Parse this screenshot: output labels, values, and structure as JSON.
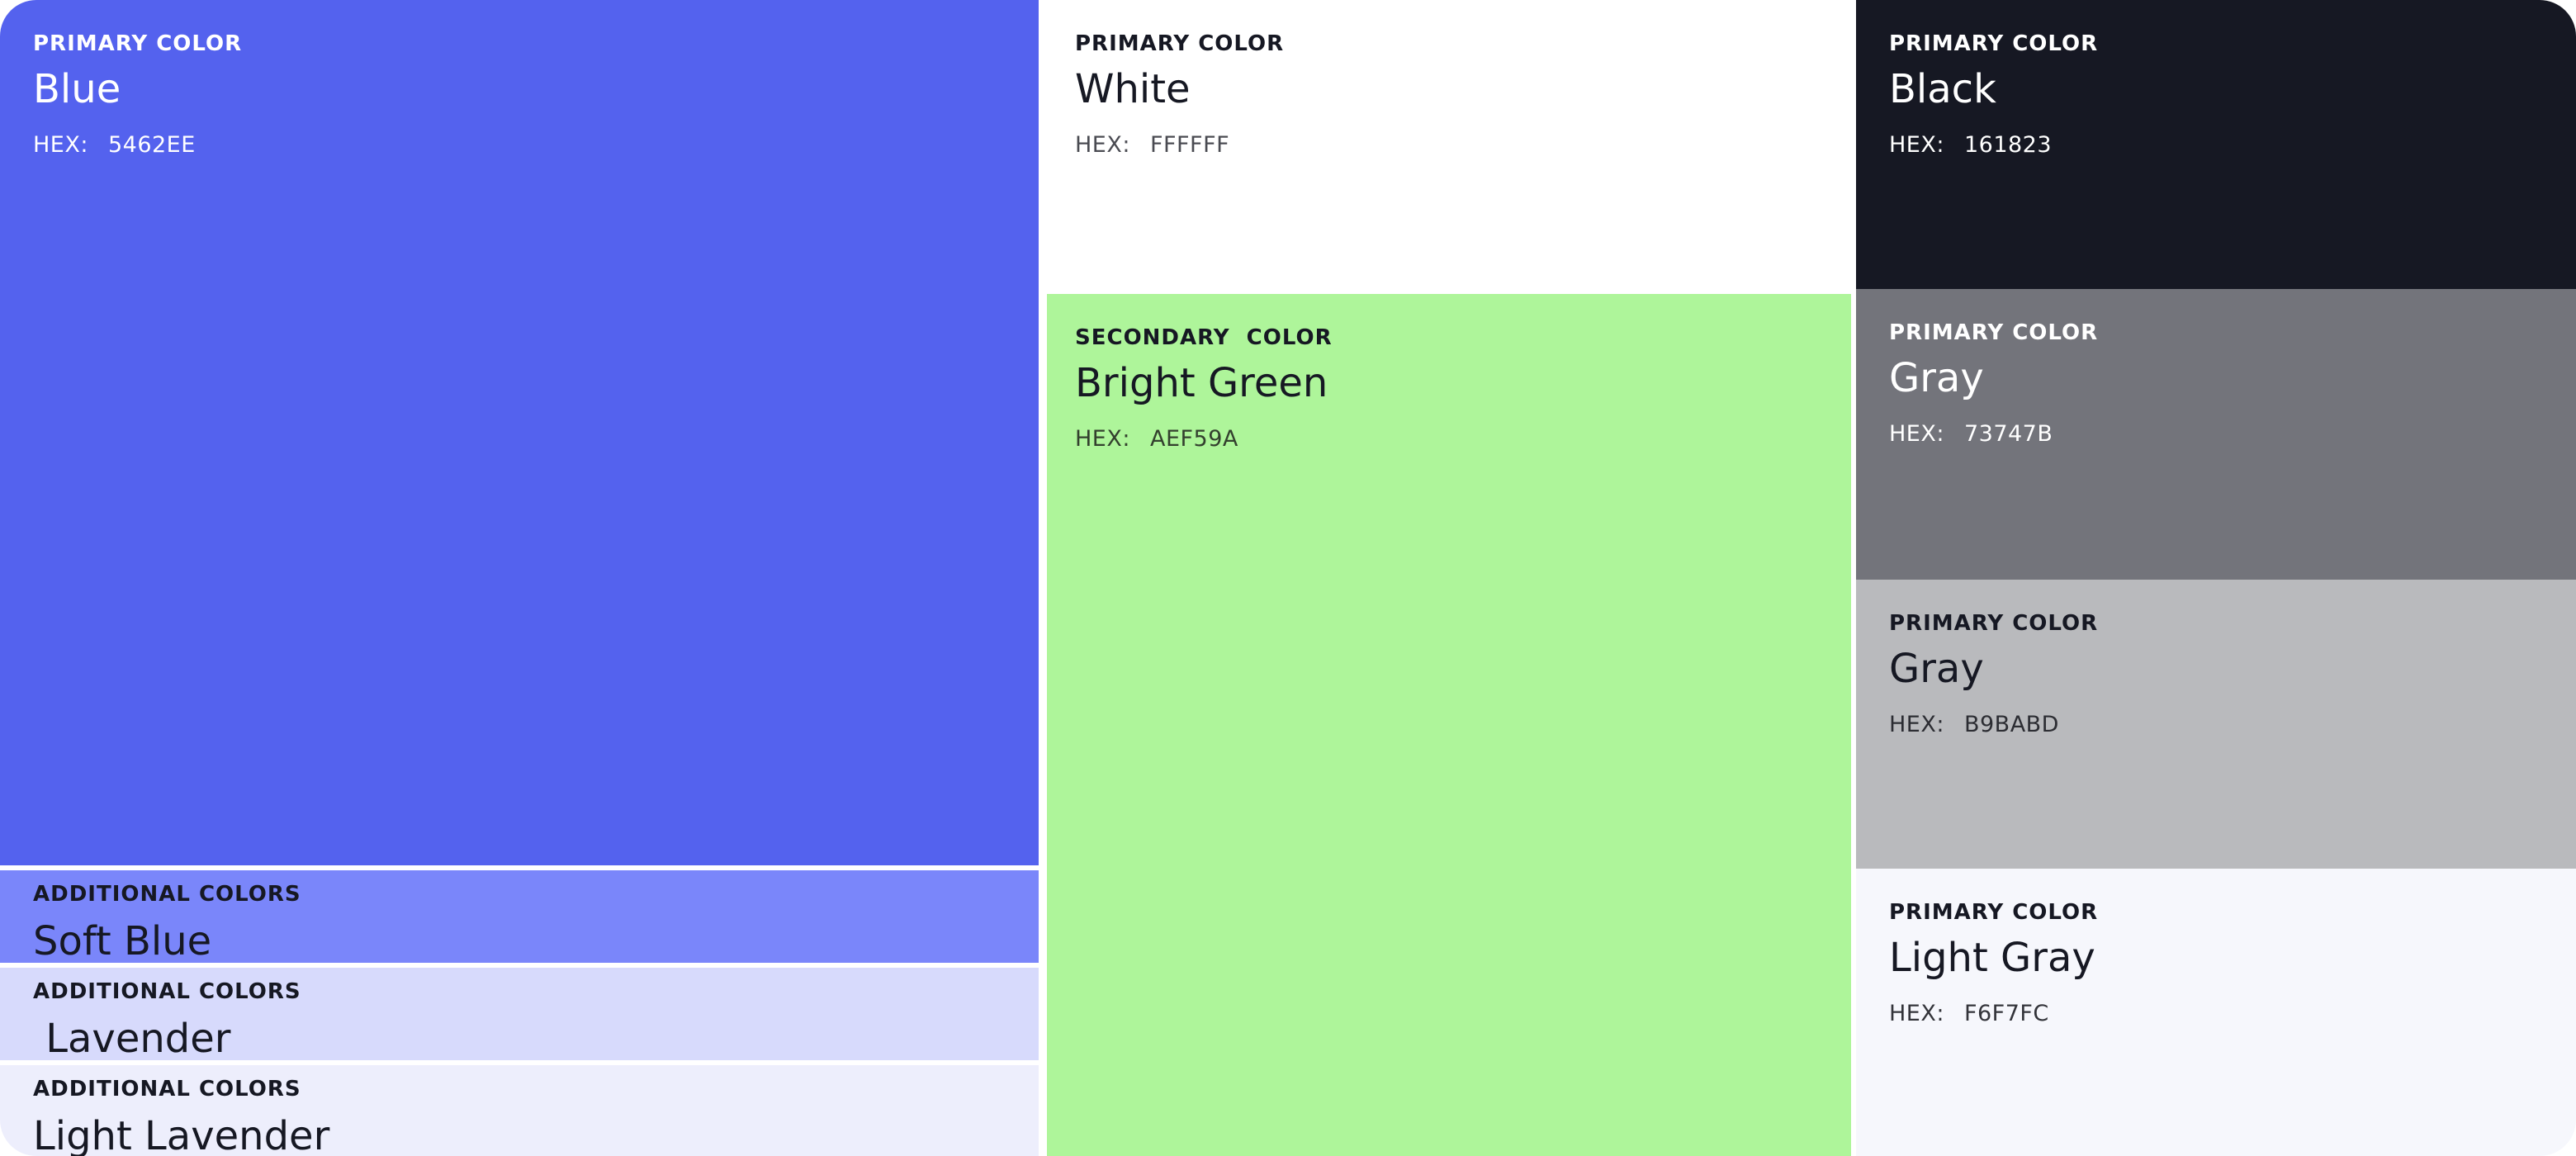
{
  "swatches": {
    "blue": {
      "label": "PRIMARY COLOR",
      "name": "Blue",
      "hex_prefix": "HEX:",
      "hex": "5462EE"
    },
    "soft_blue": {
      "label": "ADDITIONAL COLORS",
      "name": "Soft Blue"
    },
    "lavender": {
      "label": "ADDITIONAL COLORS",
      "name": " Lavender"
    },
    "light_lavender": {
      "label": "ADDITIONAL COLORS",
      "name": "Light Lavender"
    },
    "white": {
      "label": "PRIMARY COLOR",
      "name": "White",
      "hex_prefix": "HEX:",
      "hex": "FFFFFF"
    },
    "bright_green": {
      "label": "SECONDARY  COLOR",
      "name": "Bright Green",
      "hex_prefix": "HEX:",
      "hex": "AEF59A"
    },
    "black": {
      "label": "PRIMARY COLOR",
      "name": "Black",
      "hex_prefix": "HEX:",
      "hex": "161823"
    },
    "gray_dark": {
      "label": "PRIMARY COLOR",
      "name": "Gray",
      "hex_prefix": "HEX:",
      "hex": "73747B"
    },
    "gray_light": {
      "label": "PRIMARY COLOR",
      "name": "Gray",
      "hex_prefix": "HEX:",
      "hex": "B9BABD"
    },
    "light_gray": {
      "label": "PRIMARY COLOR",
      "name": "Light Gray",
      "hex_prefix": "HEX:",
      "hex": "F6F7FC"
    }
  },
  "colors": {
    "blue": "#5462EE",
    "soft_blue": "#7A86FA",
    "lavender": "#D7DAFC",
    "light_lavender": "#EDEEFC",
    "white": "#FFFFFF",
    "bright_green": "#AEF59A",
    "black": "#161823",
    "gray_dark": "#73747B",
    "gray_light": "#B9BABD",
    "light_gray": "#F6F7FC",
    "text_dark": "#161823",
    "text_light": "#FFFFFF"
  }
}
